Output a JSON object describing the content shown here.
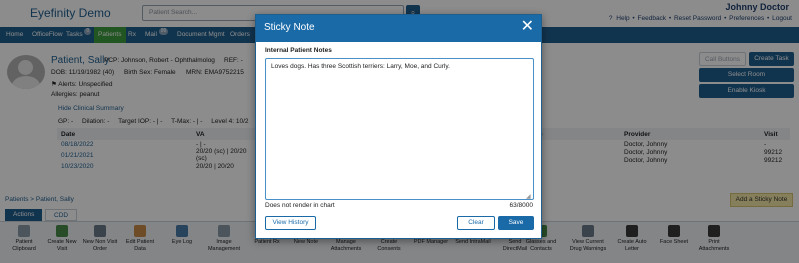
{
  "app": {
    "brand": "Eyefinity Demo",
    "search_placeholder": "Patient Search...",
    "user": "Johnny Doctor",
    "top_links": [
      "Help",
      "Feedback",
      "Reset Password",
      "Preferences",
      "Logout"
    ]
  },
  "nav": {
    "items": [
      {
        "label": "Home"
      },
      {
        "label": "OfficeFlow"
      },
      {
        "label": "Tasks",
        "badge": "0"
      },
      {
        "label": "Patients",
        "active": true
      },
      {
        "label": "Rx"
      },
      {
        "label": "Mail",
        "badge": "99"
      },
      {
        "label": "Document Mgmt"
      },
      {
        "label": "Orders"
      }
    ]
  },
  "patient": {
    "name": "Patient, Sally",
    "pcp": "PCP: Johnson, Robert - Ophthalmolog",
    "ref": "REF: -",
    "dob": "DOB: 11/19/1982 (40)",
    "birth_sex": "Birth Sex: Female",
    "mrn": "MRN: EMA9752215",
    "alerts": "Alerts: Unspecified",
    "allergies": "Allergies: peanut",
    "hide_summary": "Hide Clinical Summary",
    "vitals": [
      "GP: -",
      "Dilation: -",
      "Target IOP: - | -",
      "T-Max: - | -",
      "Level 4: 10/2"
    ]
  },
  "visits": {
    "headers": [
      "Date",
      "VA"
    ],
    "rows": [
      {
        "date": "08/18/2022",
        "va": "- | -"
      },
      {
        "date": "01/21/2021",
        "va": "20/20 (sc) | 20/20 (sc)"
      },
      {
        "date": "10/23/2020",
        "va": "20/20 | 20/20"
      }
    ],
    "right_headers": [
      "e",
      "Provider",
      "Visit"
    ],
    "right_rows": [
      {
        "provider": "Doctor, Johnny",
        "visit": "-"
      },
      {
        "provider": "Doctor, Johnny",
        "visit": "99212"
      },
      {
        "provider": "Doctor, Johnny",
        "visit": "99212"
      }
    ]
  },
  "right_buttons": {
    "call_buttons": "Call Buttons",
    "create_task": "Create Task",
    "select_room": "Select Room",
    "enable_kiosk": "Enable Kiosk"
  },
  "bottom": {
    "breadcrumb": "Patients > Patient, Sally",
    "sticky_note_btn": "Add a Sticky Note",
    "tabs": [
      "Actions",
      "CDD"
    ],
    "tools": [
      "Patient Clipboard",
      "Create New Visit",
      "New Non Visit Order",
      "Edit Patient Data",
      "Eye Log",
      "Image Management",
      "Patient Rx",
      "New Note",
      "Manage Attachments",
      "Create Consents",
      "PDF Manager",
      "Send IntraMail",
      "Send DirectMail",
      "Glasses and Contacts",
      "View Current Drug Warnings",
      "Create Auto Letter",
      "Face Sheet",
      "Print Attachments"
    ]
  },
  "modal": {
    "title": "Sticky Note",
    "label": "Internal Patient Notes",
    "note_text": "Loves dogs. Has three Scottish terriers: Larry, Moe, and Curly.",
    "hint": "Does not render in chart",
    "count": "63/8000",
    "view_history": "View History",
    "clear": "Clear",
    "save": "Save"
  },
  "colors": {
    "primary": "#1f5f8f",
    "active_nav": "#3d9b3d",
    "sticky": "#f5e8a6"
  }
}
